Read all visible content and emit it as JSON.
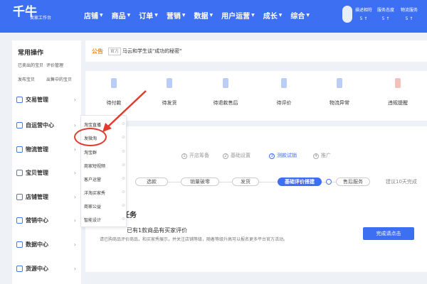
{
  "header": {
    "logo": "千牛",
    "logo_sub": "卖家工作台",
    "nav": [
      "店铺",
      "商品",
      "订单",
      "营销",
      "数据",
      "用户运营",
      "成长",
      "综合"
    ],
    "metrics": [
      {
        "label": "描述相符",
        "value": "5 ↑"
      },
      {
        "label": "服务态度",
        "value": "5 ↑"
      },
      {
        "label": "物流服务",
        "value": "5 ↑"
      }
    ]
  },
  "sidebar": {
    "title": "常用操作",
    "quick_links": [
      "已卖出的宝贝",
      "评价管理",
      "发布宝贝",
      "出售中的宝贝"
    ],
    "menu": [
      "交易管理",
      "自运营中心",
      "物流管理",
      "宝贝管理",
      "店铺管理",
      "营销中心",
      "数据中心",
      "货源中心"
    ]
  },
  "submenu": {
    "items": [
      "淘宝直播",
      "发微淘",
      "淘宝群",
      "商家短视频",
      "客户运营",
      "洋淘买家秀",
      "商家公益",
      "智能设计"
    ]
  },
  "announcement": {
    "label": "公告",
    "tag": "官方",
    "text": "马云和学生谈\"成功的秘密\""
  },
  "order_status": [
    "待付款",
    "待发货",
    "待退款售后",
    "待评价",
    "物流异常",
    "违规提醒"
  ],
  "onboarding": {
    "phases": [
      {
        "num": "1",
        "label": "开店筹备"
      },
      {
        "num": "2",
        "label": "基础设置"
      },
      {
        "num": "3",
        "label": "测款试销"
      },
      {
        "num": "4",
        "label": "推广"
      }
    ],
    "steps": [
      "选款",
      "销量破零",
      "发货",
      "基础评价搭建",
      "售后服务"
    ],
    "hint": "建议10天完成",
    "task_heading": "任务",
    "task_title": "已有1款商品有买家评价",
    "task_desc": "请已购商品评价商品，和买家秀展示，并关注店铺等级，随着等级升高可以报名更多平台官方活动。",
    "button": "完成请点击"
  },
  "colors": {
    "primary": "#3d6ff2",
    "announce": "#f08c1a",
    "highlight": "#e23a2e"
  }
}
